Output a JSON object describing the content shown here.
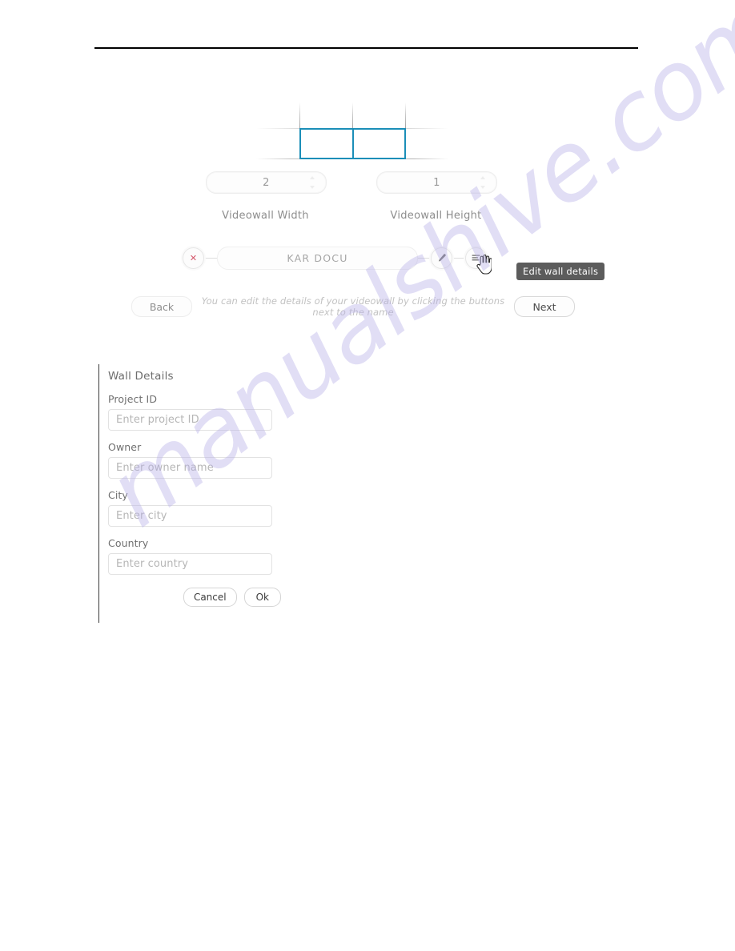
{
  "page": {
    "watermark": "manualshive.com",
    "accent_color": "#1b8eb8",
    "tooltip_bg": "#5c5c5c"
  },
  "wall_diagram": {
    "columns": 2,
    "rows": 1,
    "outline_color": "#1b8eb8"
  },
  "dimensions": {
    "width": {
      "value": "2",
      "label": "Videowall Width"
    },
    "height": {
      "value": "1",
      "label": "Videowall Height"
    }
  },
  "name_row": {
    "delete_glyph": "✕",
    "wall_name": "KAR DOCU",
    "edit_name_icon": "pencil-icon",
    "details_icon": "details-list-icon",
    "tooltip": "Edit wall details"
  },
  "navigation": {
    "back_label": "Back",
    "hint": "You can edit the details of your videowall by clicking the buttons next to the name",
    "next_label": "Next"
  },
  "wall_details": {
    "title": "Wall Details",
    "fields": [
      {
        "label": "Project ID",
        "value": "",
        "placeholder": "Enter project ID"
      },
      {
        "label": "Owner",
        "value": "",
        "placeholder": "Enter owner name"
      },
      {
        "label": "City",
        "value": "",
        "placeholder": "Enter city"
      },
      {
        "label": "Country",
        "value": "",
        "placeholder": "Enter country"
      }
    ],
    "cancel_label": "Cancel",
    "ok_label": "Ok"
  }
}
